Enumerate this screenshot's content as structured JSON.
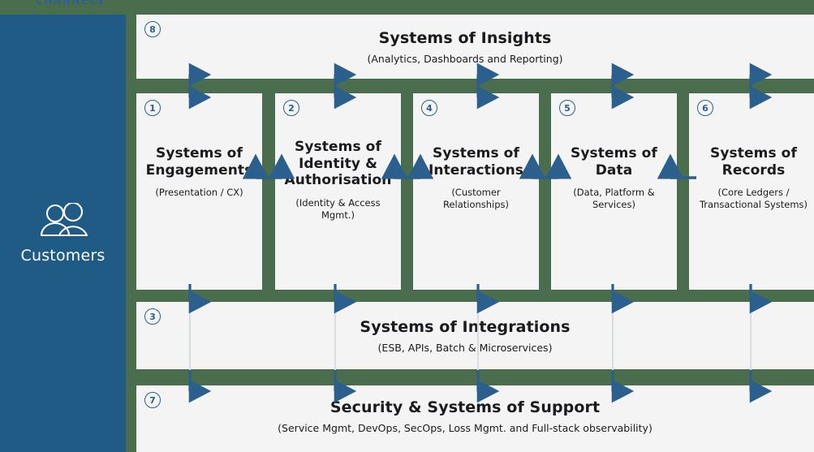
{
  "channels": {
    "label": "CHANNELS"
  },
  "sidebar": {
    "label": "Customers",
    "icon": "customers-icon"
  },
  "bands": {
    "insights": {
      "badge": "8",
      "title": "Systems of Insights",
      "subtitle": "(Analytics, Dashboards and Reporting)"
    },
    "integrations": {
      "badge": "3",
      "title": "Systems of Integrations",
      "subtitle": "(ESB, APIs, Batch & Microservices)"
    },
    "support": {
      "badge": "7",
      "title": "Security & Systems of Support",
      "subtitle": "(Service Mgmt, DevOps, SecOps, Loss Mgmt. and Full-stack observability)"
    }
  },
  "columns": [
    {
      "badge": "1",
      "title": "Systems of Engagements",
      "subtitle": "(Presentation / CX)"
    },
    {
      "badge": "2",
      "title": "Systems of Identity & Authorisation",
      "subtitle": "(Identity & Access Mgmt.)"
    },
    {
      "badge": "4",
      "title": "Systems of Interactions",
      "subtitle": "(Customer Relationships)"
    },
    {
      "badge": "5",
      "title": "Systems of Data",
      "subtitle": "(Data, Platform & Services)"
    },
    {
      "badge": "6",
      "title": "Systems of Records",
      "subtitle": "(Core Ledgers / Transactional Systems)"
    }
  ],
  "colors": {
    "background_green": "#4a6d4d",
    "sidebar_blue": "#1f5b85",
    "panel_grey": "#f4f4f4",
    "accent_blue": "#2b5f8e",
    "text_dark": "#1b1b1f"
  }
}
